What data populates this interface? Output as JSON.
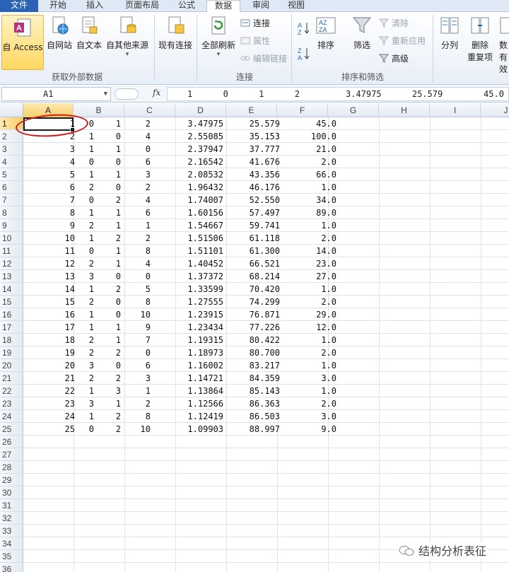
{
  "ribbon": {
    "tabs": [
      {
        "label": "文件",
        "name": "tab-file"
      },
      {
        "label": "开始",
        "name": "tab-home"
      },
      {
        "label": "插入",
        "name": "tab-insert"
      },
      {
        "label": "页面布局",
        "name": "tab-page-layout"
      },
      {
        "label": "公式",
        "name": "tab-formulas"
      },
      {
        "label": "数据",
        "name": "tab-data"
      },
      {
        "label": "审阅",
        "name": "tab-review"
      },
      {
        "label": "视图",
        "name": "tab-view"
      }
    ],
    "active_tab": "数据",
    "groups": {
      "external": {
        "label": "获取外部数据",
        "from_access": "自 Access",
        "from_web": "自网站",
        "from_text": "自文本",
        "from_other": "自其他来源",
        "existing": "现有连接"
      },
      "connections": {
        "label": "连接",
        "refresh_all": "全部刷新",
        "connections": "连接",
        "properties": "属性",
        "edit_links": "编辑链接"
      },
      "sort_filter": {
        "label": "排序和筛选",
        "sort": "排序",
        "filter": "筛选",
        "clear": "清除",
        "reapply": "重新应用",
        "advanced": "高级"
      },
      "data_tools": {
        "text_to_columns": "分列",
        "remove_dup_1": "删除",
        "remove_dup_2": "重复项",
        "data_validation_1": "数",
        "data_validation_2": "有效"
      }
    },
    "accent": "#2a62b8"
  },
  "formula_bar": {
    "name_box": "A1",
    "fx": "fx",
    "content": "1      0      1      2         3.47975      25.579        45.0"
  },
  "sheet": {
    "columns": [
      "A",
      "B",
      "C",
      "D",
      "E",
      "F",
      "G",
      "H",
      "I",
      "J"
    ],
    "selected_column": "A",
    "row_numbers": [
      "1",
      "2",
      "3",
      "4",
      "5",
      "6",
      "7",
      "8",
      "9",
      "10",
      "11",
      "12",
      "13",
      "14",
      "15",
      "16",
      "17",
      "18",
      "19",
      "20",
      "21",
      "22",
      "23",
      "24",
      "25",
      "26",
      "27",
      "28",
      "29",
      "30",
      "31",
      "32",
      "33",
      "34",
      "35",
      "36"
    ],
    "selected_row": "1",
    "rows": [
      [
        "1",
        "0",
        "1",
        "2",
        "3.47975",
        "25.579",
        "45.0"
      ],
      [
        "2",
        "1",
        "0",
        "4",
        "2.55085",
        "35.153",
        "100.0"
      ],
      [
        "3",
        "1",
        "1",
        "0",
        "2.37947",
        "37.777",
        "21.0"
      ],
      [
        "4",
        "0",
        "0",
        "6",
        "2.16542",
        "41.676",
        "2.0"
      ],
      [
        "5",
        "1",
        "1",
        "3",
        "2.08532",
        "43.356",
        "66.0"
      ],
      [
        "6",
        "2",
        "0",
        "2",
        "1.96432",
        "46.176",
        "1.0"
      ],
      [
        "7",
        "0",
        "2",
        "4",
        "1.74007",
        "52.550",
        "34.0"
      ],
      [
        "8",
        "1",
        "1",
        "6",
        "1.60156",
        "57.497",
        "89.0"
      ],
      [
        "9",
        "2",
        "1",
        "1",
        "1.54667",
        "59.741",
        "1.0"
      ],
      [
        "10",
        "1",
        "2",
        "2",
        "1.51506",
        "61.118",
        "2.0"
      ],
      [
        "11",
        "0",
        "1",
        "8",
        "1.51101",
        "61.300",
        "14.0"
      ],
      [
        "12",
        "2",
        "1",
        "4",
        "1.40452",
        "66.521",
        "23.0"
      ],
      [
        "13",
        "3",
        "0",
        "0",
        "1.37372",
        "68.214",
        "27.0"
      ],
      [
        "14",
        "1",
        "2",
        "5",
        "1.33599",
        "70.420",
        "1.0"
      ],
      [
        "15",
        "2",
        "0",
        "8",
        "1.27555",
        "74.299",
        "2.0"
      ],
      [
        "16",
        "1",
        "0",
        "10",
        "1.23915",
        "76.871",
        "29.0"
      ],
      [
        "17",
        "1",
        "1",
        "9",
        "1.23434",
        "77.226",
        "12.0"
      ],
      [
        "18",
        "2",
        "1",
        "7",
        "1.19315",
        "80.422",
        "1.0"
      ],
      [
        "19",
        "2",
        "2",
        "0",
        "1.18973",
        "80.700",
        "2.0"
      ],
      [
        "20",
        "3",
        "0",
        "6",
        "1.16002",
        "83.217",
        "1.0"
      ],
      [
        "21",
        "2",
        "2",
        "3",
        "1.14721",
        "84.359",
        "3.0"
      ],
      [
        "22",
        "1",
        "3",
        "1",
        "1.13864",
        "85.143",
        "1.0"
      ],
      [
        "23",
        "3",
        "1",
        "2",
        "1.12566",
        "86.363",
        "2.0"
      ],
      [
        "24",
        "1",
        "2",
        "8",
        "1.12419",
        "86.503",
        "3.0"
      ],
      [
        "25",
        "0",
        "2",
        "10",
        "1.09903",
        "88.997",
        "9.0"
      ]
    ]
  },
  "annotation_color": "#d01818",
  "watermark": "结构分析表征"
}
